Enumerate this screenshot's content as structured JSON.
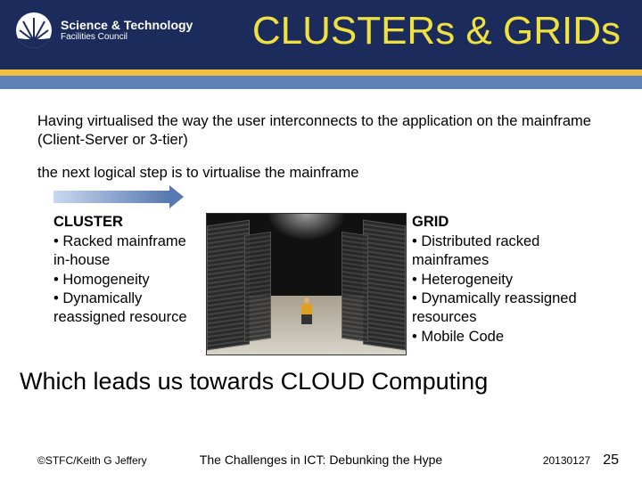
{
  "header": {
    "org_line1": "Science & Technology",
    "org_line2": "Facilities Council",
    "title": "CLUSTERs & GRIDs"
  },
  "body": {
    "intro": "Having virtualised the way the user interconnects to the application on the mainframe  (Client-Server or 3-tier)",
    "step": "the next logical step is to virtualise the mainframe",
    "cluster": {
      "heading": "CLUSTER",
      "bullets": [
        "Racked mainframe in-house",
        "Homogeneity",
        "Dynamically reassigned resource"
      ]
    },
    "grid": {
      "heading": "GRID",
      "bullets": [
        "Distributed racked mainframes",
        "Heterogeneity",
        "Dynamically reassigned resources",
        "Mobile Code"
      ]
    },
    "conclusion": "Which leads us towards CLOUD Computing"
  },
  "footer": {
    "copyright": "©STFC/Keith G Jeffery",
    "subtitle": "The Challenges in ICT: Debunking the Hype",
    "date": "20130127",
    "page": "25"
  }
}
